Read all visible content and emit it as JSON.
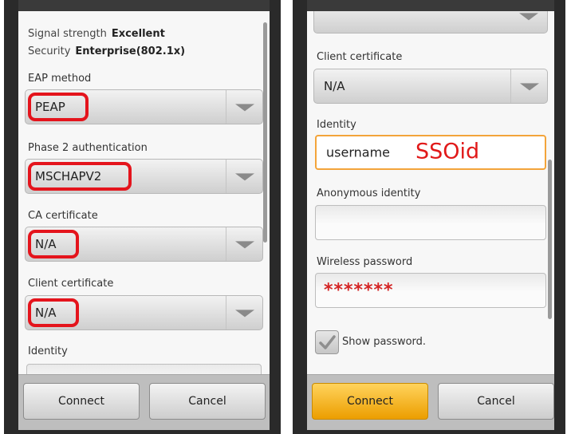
{
  "left": {
    "signal_label": "Signal strength",
    "signal_value": "Excellent",
    "security_label": "Security",
    "security_value": "Enterprise(802.1x)",
    "eap_label": "EAP method",
    "eap_value": "PEAP",
    "phase2_label": "Phase 2 authentication",
    "phase2_value": "MSCHAPV2",
    "ca_label": "CA certificate",
    "ca_value": "N/A",
    "client_label": "Client certificate",
    "client_value": "N/A",
    "identity_label": "Identity",
    "connect_label": "Connect",
    "cancel_label": "Cancel"
  },
  "right": {
    "client_label": "Client certificate",
    "client_value": "N/A",
    "identity_label": "Identity",
    "identity_value": "username",
    "identity_annotation": "SSOid",
    "anon_label": "Anonymous identity",
    "anon_value": "",
    "password_label": "Wireless password",
    "password_value": "*******",
    "show_password_label": "Show password.",
    "show_password_checked": true,
    "connect_label": "Connect",
    "cancel_label": "Cancel"
  },
  "colors": {
    "highlight_red": "#e4141c",
    "focus_orange": "#f3a43a",
    "primary_button": "#f5b321",
    "dialog_background": "#f7f7f7",
    "screen_background": "#2a2a2a"
  }
}
